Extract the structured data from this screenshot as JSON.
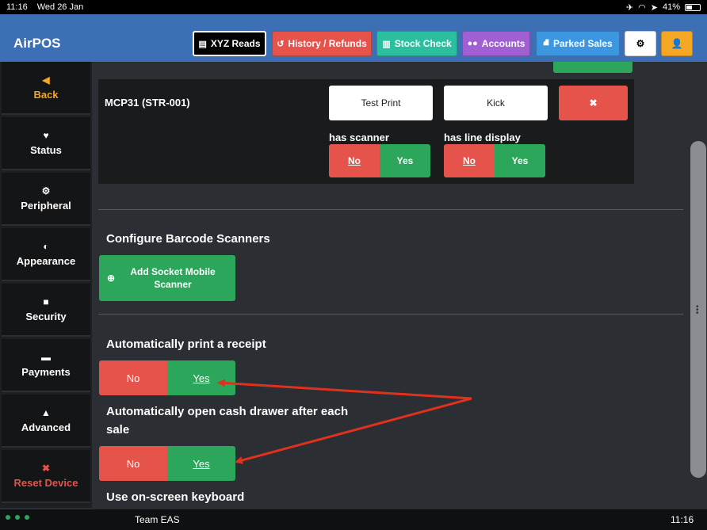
{
  "statusbar": {
    "time": "11:16",
    "date": "Wed 26 Jan",
    "battery": "41%",
    "icons": [
      "airplane-icon",
      "wifi-icon",
      "location-icon",
      "battery-icon"
    ]
  },
  "header": {
    "brand": "AirPOS",
    "buttons": [
      {
        "label": "XYZ Reads",
        "icon": "register-icon",
        "color": "#000000"
      },
      {
        "label": "History / Refunds",
        "icon": "history-icon",
        "color": "#e5534b"
      },
      {
        "label": "Stock Check",
        "icon": "barcode-icon",
        "color": "#2cbf9f"
      },
      {
        "label": "Accounts",
        "icon": "users-icon",
        "color": "#a15fd4"
      },
      {
        "label": "Parked Sales",
        "icon": "road-icon",
        "color": "#3d97e0"
      }
    ]
  },
  "sidebar": {
    "items": [
      {
        "label": "Back",
        "icon": "back-circle-icon"
      },
      {
        "label": "Status",
        "icon": "heartbeat-icon"
      },
      {
        "label": "Peripheral",
        "icon": "gear-icon"
      },
      {
        "label": "Appearance",
        "icon": "contrast-icon"
      },
      {
        "label": "Security",
        "icon": "lock-icon"
      },
      {
        "label": "Payments",
        "icon": "cart-icon"
      },
      {
        "label": "Advanced",
        "icon": "warning-icon"
      },
      {
        "label": "Reset Device",
        "icon": "close-icon"
      }
    ]
  },
  "printer": {
    "name": "MCP31 (STR-001)",
    "test_print": "Test Print",
    "kick": "Kick",
    "remove": "✖",
    "scanner_label": "has scanner",
    "line_display_label": "has line display",
    "no": "No",
    "yes": "Yes"
  },
  "scanners": {
    "title": "Configure Barcode Scanners",
    "add_button": "Add Socket Mobile Scanner"
  },
  "settings": {
    "auto_print_title": "Automatically print a receipt",
    "cash_drawer_title": "Automatically open cash drawer after each sale",
    "keyboard_title": "Use on-screen keyboard",
    "no": "No",
    "yes": "Yes"
  },
  "bottombar": {
    "team": "Team EAS",
    "time": "11:16"
  },
  "colors": {
    "accent_blue": "#3d6fb4",
    "red": "#e5534b",
    "green": "#2ca65a",
    "orange": "#f5a623",
    "annotation": "#e0301e"
  }
}
